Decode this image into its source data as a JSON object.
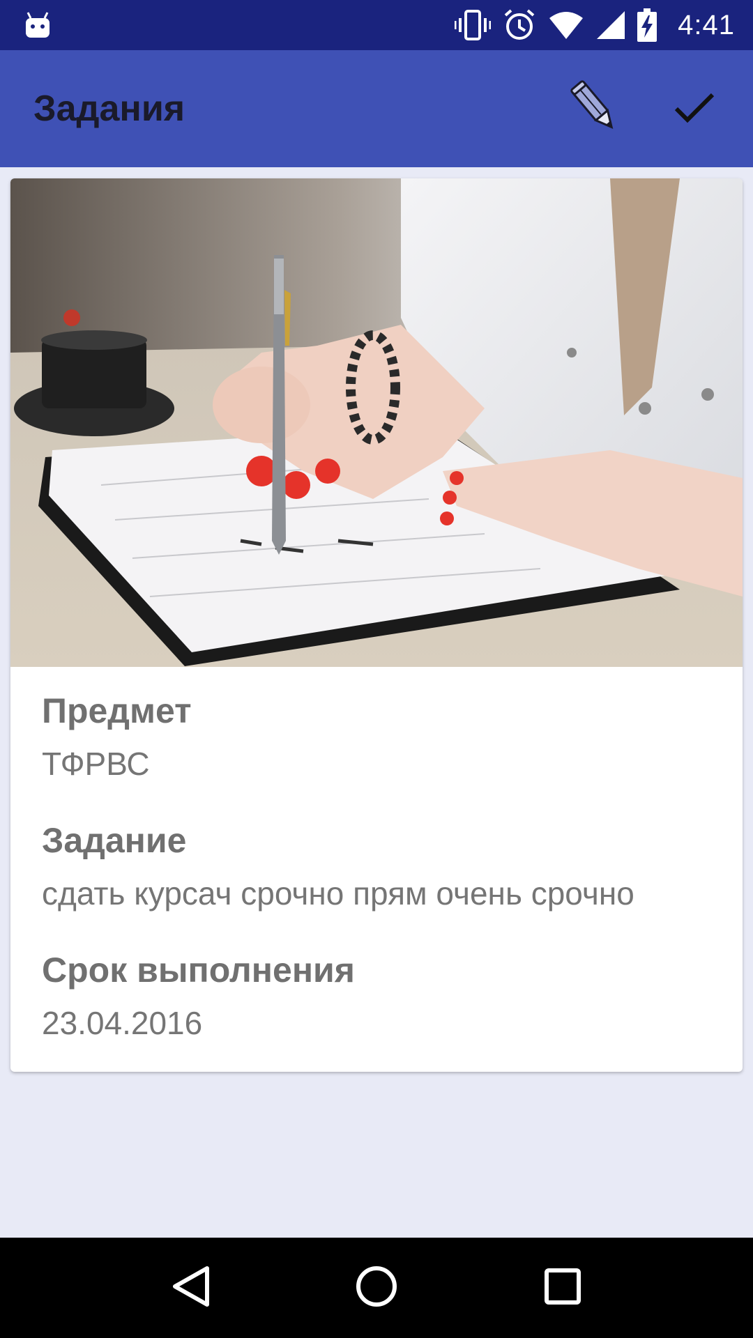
{
  "status_bar": {
    "time": "4:41",
    "icons": [
      "android-notification-icon",
      "vibrate-icon",
      "alarm-icon",
      "wifi-icon",
      "signal-icon",
      "battery-charging-icon"
    ]
  },
  "app_bar": {
    "title": "Задания",
    "actions": [
      "pencil-icon",
      "check-icon"
    ]
  },
  "card": {
    "image": "photo of a hand writing in a notebook with a pen",
    "fields": [
      {
        "label": "Предмет",
        "value": "ТФРВС"
      },
      {
        "label": "Задание",
        "value": "сдать курсач срочно прям очень срочно"
      },
      {
        "label": "Срок выполнения",
        "value": "23.04.2016"
      }
    ]
  },
  "nav_bar": {
    "buttons": [
      "back-icon",
      "home-icon",
      "recents-icon"
    ]
  },
  "colors": {
    "status_bar": "#1a237e",
    "app_bar": "#3f51b5",
    "background": "#e8eaf6",
    "card": "#ffffff",
    "label_text": "#707070",
    "value_text": "#757575"
  }
}
